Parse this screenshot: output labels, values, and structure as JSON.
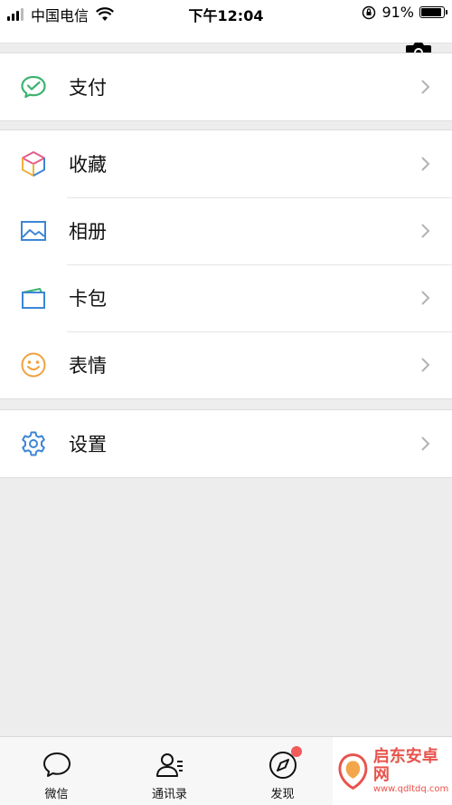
{
  "status_bar": {
    "carrier": "中国电信",
    "time": "下午12:04",
    "battery": "91%",
    "battery_level": 0.91
  },
  "groups": [
    {
      "items": [
        {
          "label": "支付",
          "icon": "pay-icon"
        }
      ]
    },
    {
      "items": [
        {
          "label": "收藏",
          "icon": "favorites-cube-icon"
        },
        {
          "label": "相册",
          "icon": "album-picture-icon"
        },
        {
          "label": "卡包",
          "icon": "card-wallet-icon"
        },
        {
          "label": "表情",
          "icon": "sticker-smiley-icon"
        }
      ]
    },
    {
      "items": [
        {
          "label": "设置",
          "icon": "settings-gear-icon"
        }
      ]
    }
  ],
  "tabs": [
    {
      "label": "微信",
      "icon": "chat-bubble-icon"
    },
    {
      "label": "通讯录",
      "icon": "contacts-icon"
    },
    {
      "label": "发现",
      "icon": "compass-icon"
    },
    {
      "label": "",
      "icon": "me-icon"
    }
  ],
  "watermark": {
    "title": "启东安卓网",
    "url": "www.qdltdq.com"
  },
  "colors": {
    "pay_green": "#3cb371",
    "blue": "#3d86d6",
    "orange": "#f0a040",
    "badge_red": "#f25b5b",
    "background": "#ededed"
  }
}
